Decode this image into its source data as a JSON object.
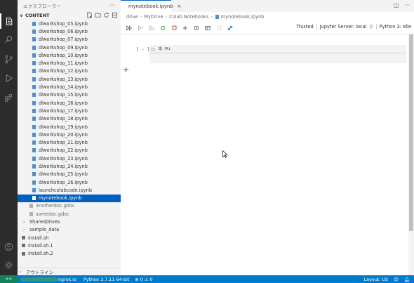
{
  "sidebar": {
    "title": "エクスプローラー",
    "section": "CONTENT",
    "files": [
      {
        "label": "dlworkshop_05.ipynb",
        "type": "notebook"
      },
      {
        "label": "dlworkshop_06.ipynb",
        "type": "notebook"
      },
      {
        "label": "dlworkshop_07.ipynb",
        "type": "notebook"
      },
      {
        "label": "dlworkshop_09.ipynb",
        "type": "notebook"
      },
      {
        "label": "dlworkshop_10.ipynb",
        "type": "notebook"
      },
      {
        "label": "dlworkshop_11.ipynb",
        "type": "notebook"
      },
      {
        "label": "dlworkshop_12.ipynb",
        "type": "notebook"
      },
      {
        "label": "dlworkshop_13.ipynb",
        "type": "notebook"
      },
      {
        "label": "dlworkshop_14.ipynb",
        "type": "notebook"
      },
      {
        "label": "dlworkshop_15.ipynb",
        "type": "notebook"
      },
      {
        "label": "dlworkshop_16.ipynb",
        "type": "notebook"
      },
      {
        "label": "dlworkshop_17.ipynb",
        "type": "notebook"
      },
      {
        "label": "dlworkshop_18.ipynb",
        "type": "notebook"
      },
      {
        "label": "dlworkshop_19.ipynb",
        "type": "notebook"
      },
      {
        "label": "dlworkshop_20.ipynb",
        "type": "notebook"
      },
      {
        "label": "dlworkshop_21.ipynb",
        "type": "notebook"
      },
      {
        "label": "dlworkshop_22.ipynb",
        "type": "notebook"
      },
      {
        "label": "dlworkshop_23.ipynb",
        "type": "notebook"
      },
      {
        "label": "dlworkshop_24.ipynb",
        "type": "notebook"
      },
      {
        "label": "dlworkshop_25.ipynb",
        "type": "notebook"
      },
      {
        "label": "dlworkshop_26.ipynb",
        "type": "notebook"
      },
      {
        "label": "launchcolabcode.ipynb",
        "type": "notebook"
      },
      {
        "label": "mynotebook.ipynb",
        "type": "notebook",
        "selected": true
      },
      {
        "label": "anotherdoc.gdoc",
        "type": "gdoc"
      },
      {
        "label": "somedoc.gdoc",
        "type": "gdoc"
      }
    ],
    "folders": [
      {
        "label": "Shareddrives",
        "depth": 1
      },
      {
        "label": "sample_data",
        "depth": 0
      }
    ],
    "root_files": [
      {
        "label": "install.sh"
      },
      {
        "label": "install.sh.1"
      },
      {
        "label": "install.sh.2"
      }
    ],
    "outline_label": "アウトライン"
  },
  "editor": {
    "tab_label": "mynotebook.ipynb",
    "breadcrumb": [
      "drive",
      "MyDrive",
      "Colab Notebooks",
      "mynotebook.ipynb"
    ],
    "toolbar_right": [
      "Trusted",
      "Jupyter Server: local",
      "Python 3: Idle"
    ],
    "cell_exec_count": "[ - ]",
    "cell_md_label": "M↓"
  },
  "status": {
    "remote_label": "><",
    "ngrok": "ngrok.io",
    "python": "Python 3.7.11 64-bit",
    "problems": "⊗ 0  ⚠ 0",
    "layout": "Layout: US"
  },
  "colors": {
    "accent": "#007acc",
    "selection": "#0060c0",
    "activity_bar": "#2c2c2c",
    "remote": "#16825d"
  }
}
